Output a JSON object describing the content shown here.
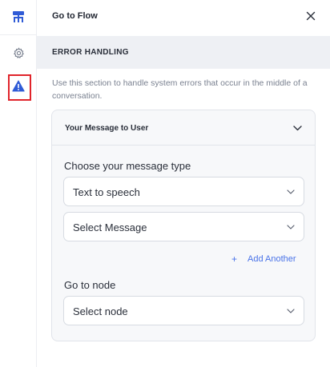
{
  "rail": {
    "items": [
      {
        "icon": "flow-icon",
        "active": false
      },
      {
        "icon": "gear-icon",
        "active": false
      },
      {
        "icon": "warning-icon",
        "active": true
      }
    ],
    "accent": "#2f5bd6",
    "highlight": "#e0242b"
  },
  "header": {
    "title": "Go to Flow",
    "close_icon": "close-icon"
  },
  "section": {
    "title": "ERROR HANDLING",
    "description": "Use this section to handle system errors that occur in the middle of a conversation."
  },
  "card": {
    "title": "Your Message to User",
    "message_type_label": "Choose your message type",
    "message_type_value": "Text to speech",
    "message_value": "Select Message",
    "add_another_label": "Add Another",
    "go_to_node_label": "Go to node",
    "node_value": "Select node"
  },
  "colors": {
    "link": "#4a73e8",
    "section_bg": "#eef0f4",
    "card_bg": "#f7f8fa"
  }
}
